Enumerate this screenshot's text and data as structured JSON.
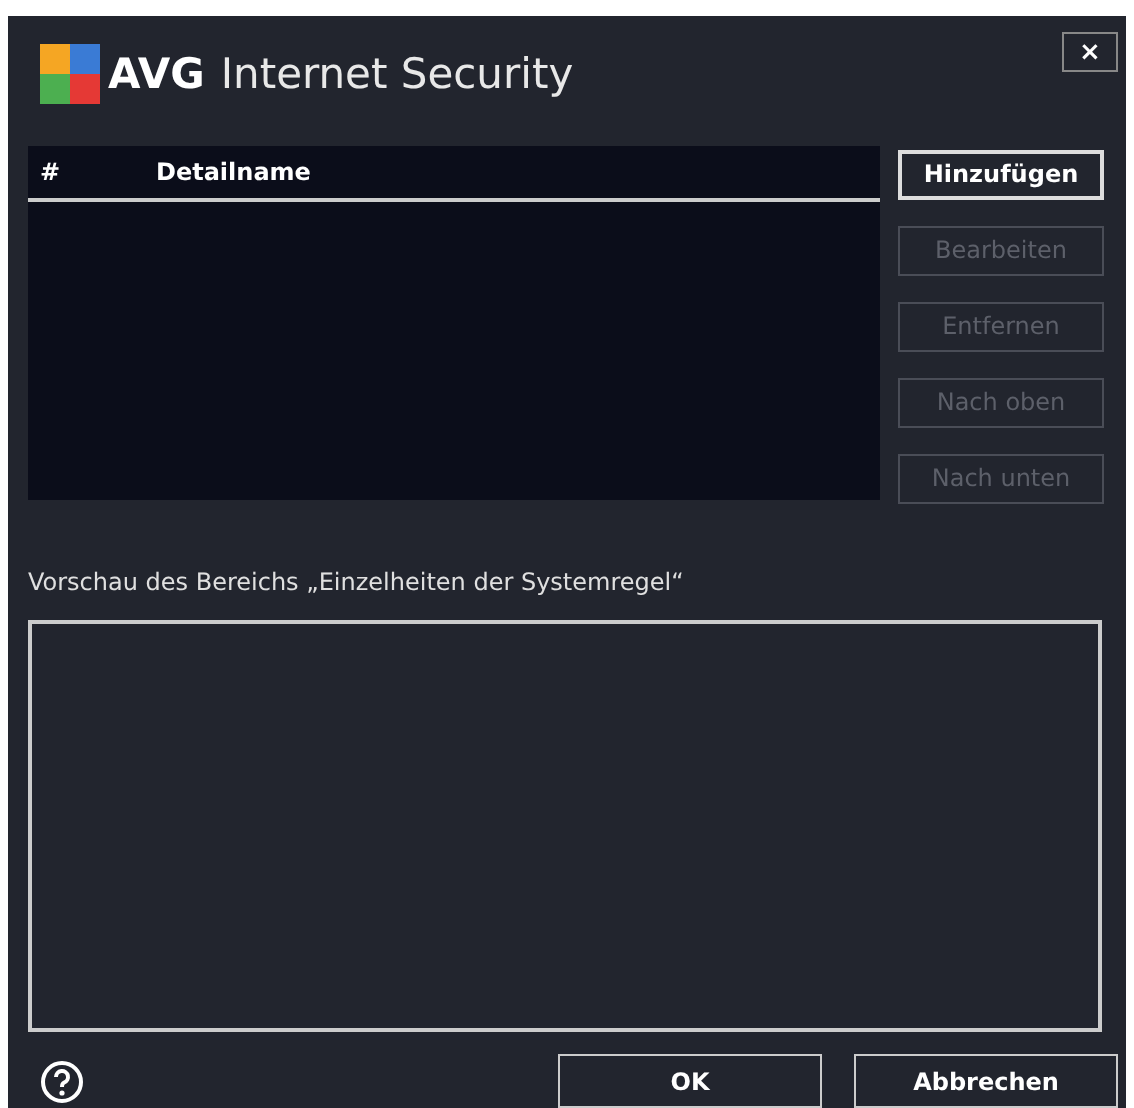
{
  "window": {
    "logo_text": "AVG",
    "title": "Internet Security",
    "close": "×"
  },
  "table": {
    "columns": [
      "#",
      "Detailname"
    ]
  },
  "side_buttons": [
    {
      "label": "Hinzufügen",
      "disabled": false
    },
    {
      "label": "Bearbeiten",
      "disabled": true
    },
    {
      "label": "Entfernen",
      "disabled": true
    },
    {
      "label": "Nach oben",
      "disabled": true
    },
    {
      "label": "Nach unten",
      "disabled": true
    }
  ],
  "preview": {
    "label": "Vorschau des Bereichs „Einzelheiten der Systemregel“"
  },
  "buttons": [
    "OK",
    "Abbrechen"
  ]
}
